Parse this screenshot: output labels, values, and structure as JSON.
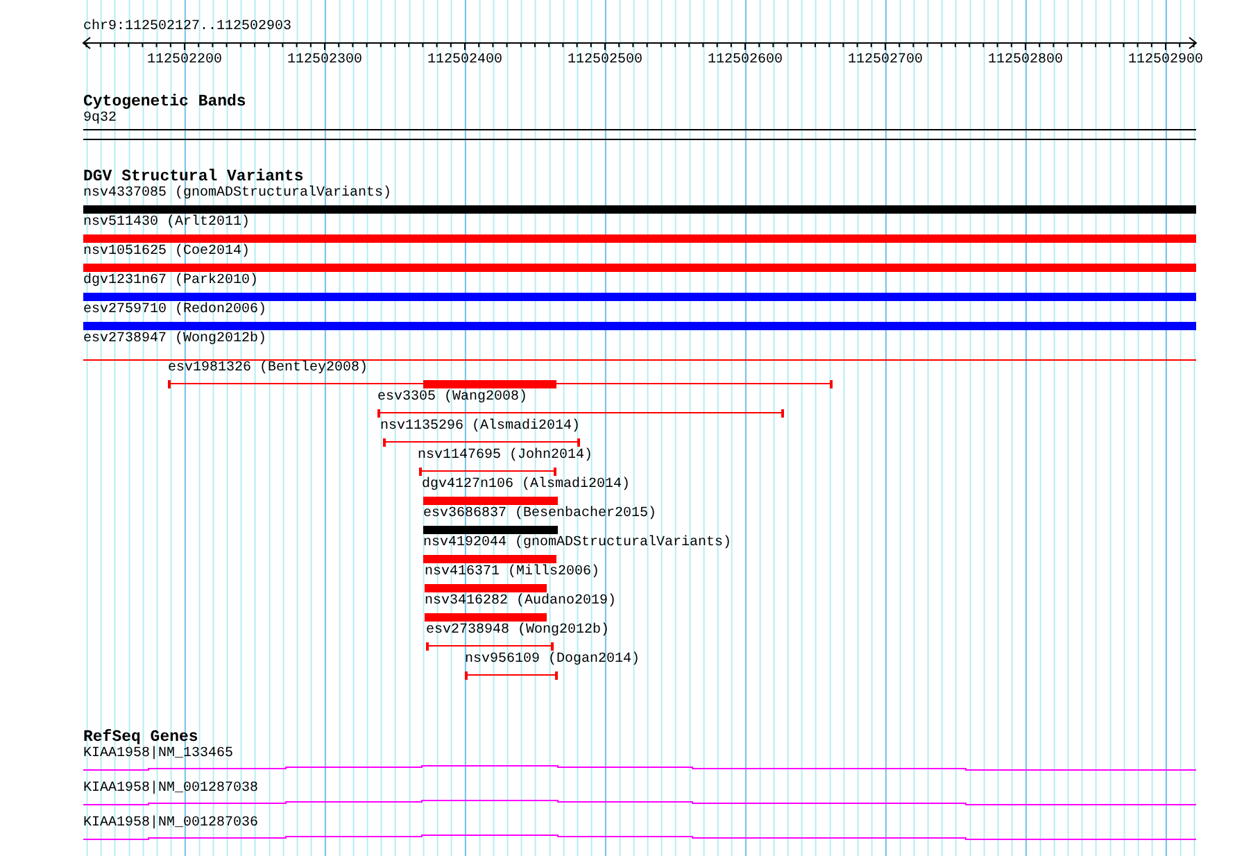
{
  "ruler": {
    "region": "chr9:112502127..112502903",
    "ticks": [
      "112502200",
      "112502300",
      "112502400",
      "112502500",
      "112502600",
      "112502700",
      "112502800",
      "112502900"
    ]
  },
  "tracks": [
    {
      "kind": "bands",
      "title": "Cytogenetic Bands",
      "features": [
        {
          "label": "9q32"
        }
      ]
    },
    {
      "kind": "variants",
      "title": "DGV Structural Variants",
      "features": [
        {
          "label": "nsv4337085 (gnomADStructuralVariants)",
          "kind": "bar",
          "color": "#000000"
        },
        {
          "label": "nsv511430 (Arlt2011)",
          "kind": "bar",
          "color": "#ff0000"
        },
        {
          "label": "nsv1051625 (Coe2014)",
          "kind": "bar",
          "color": "#ff0000"
        },
        {
          "label": "dgv1231n67 (Park2010)",
          "kind": "bar",
          "color": "#0000ff"
        },
        {
          "label": "esv2759710 (Redon2006)",
          "kind": "bar",
          "color": "#0000ff"
        },
        {
          "label": "esv2738947 (Wong2012b)",
          "kind": "line",
          "color": "#ff0000"
        },
        {
          "label": "esv1981326 (Bentley2008)",
          "kind": "span",
          "color": "#ff0000"
        },
        {
          "label": "esv3305 (Wang2008)",
          "kind": "span",
          "color": "#ff0000"
        },
        {
          "label": "nsv1135296 (Alsmadi2014)",
          "kind": "span",
          "color": "#ff0000"
        },
        {
          "label": "nsv1147695 (John2014)",
          "kind": "span",
          "color": "#ff0000"
        },
        {
          "label": "dgv4127n106 (Alsmadi2014)",
          "kind": "bar",
          "color": "#ff0000"
        },
        {
          "label": "esv3686837 (Besenbacher2015)",
          "kind": "bar",
          "color": "#000000"
        },
        {
          "label": "nsv4192044 (gnomADStructuralVariants)",
          "kind": "bar",
          "color": "#ff0000"
        },
        {
          "label": "nsv416371 (Mills2006)",
          "kind": "bar",
          "color": "#ff0000"
        },
        {
          "label": "nsv3416282 (Audano2019)",
          "kind": "bar",
          "color": "#ff0000"
        },
        {
          "label": "esv2738948 (Wong2012b)",
          "kind": "span",
          "color": "#ff0000"
        },
        {
          "label": "nsv956109 (Dogan2014)",
          "kind": "span",
          "color": "#ff0000"
        }
      ]
    },
    {
      "kind": "genes",
      "title": "RefSeq Genes",
      "features": [
        {
          "label": "KIAA1958|NM_133465"
        },
        {
          "label": "KIAA1958|NM_001287038"
        },
        {
          "label": "KIAA1958|NM_001287036"
        }
      ]
    }
  ]
}
